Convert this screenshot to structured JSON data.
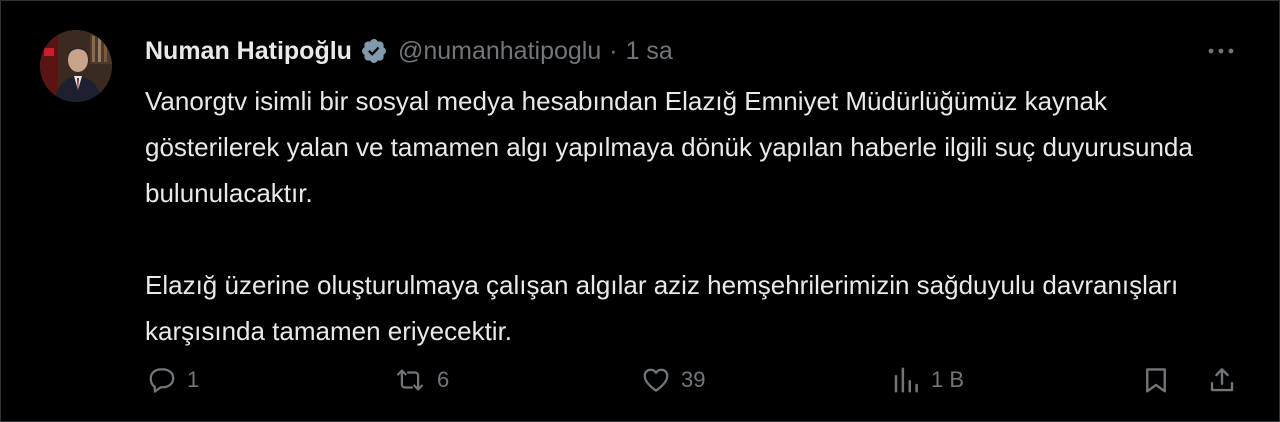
{
  "tweet": {
    "author_name": "Numan Hatipoğlu",
    "handle": "@numanhatipoglu",
    "separator": "·",
    "time": "1 sa",
    "text_paragraphs": [
      "Vanorgtv isimli bir sosyal medya hesabından Elazığ Emniyet Müdürlüğümüz kaynak gösterilerek yalan ve tamamen algı yapılmaya dönük yapılan haberle ilgili suç duyurusunda bulunulacaktır.",
      "Elazığ üzerine oluşturulmaya çalışan algılar aziz hemşehrilerimizin sağduyulu davranışları karşısında tamamen eriyecektir."
    ]
  },
  "actions": {
    "reply": {
      "icon": "reply-icon",
      "count": "1"
    },
    "retweet": {
      "icon": "retweet-icon",
      "count": "6"
    },
    "like": {
      "icon": "heart-icon",
      "count": "39"
    },
    "views": {
      "icon": "views-icon",
      "count": "1 B"
    },
    "bookmark": {
      "icon": "bookmark-icon"
    },
    "share": {
      "icon": "share-icon"
    }
  },
  "colors": {
    "background": "#000000",
    "text_primary": "#e7e9ea",
    "text_secondary": "#71767b",
    "verified_badge": "#829aab",
    "border": "#2f3336"
  }
}
